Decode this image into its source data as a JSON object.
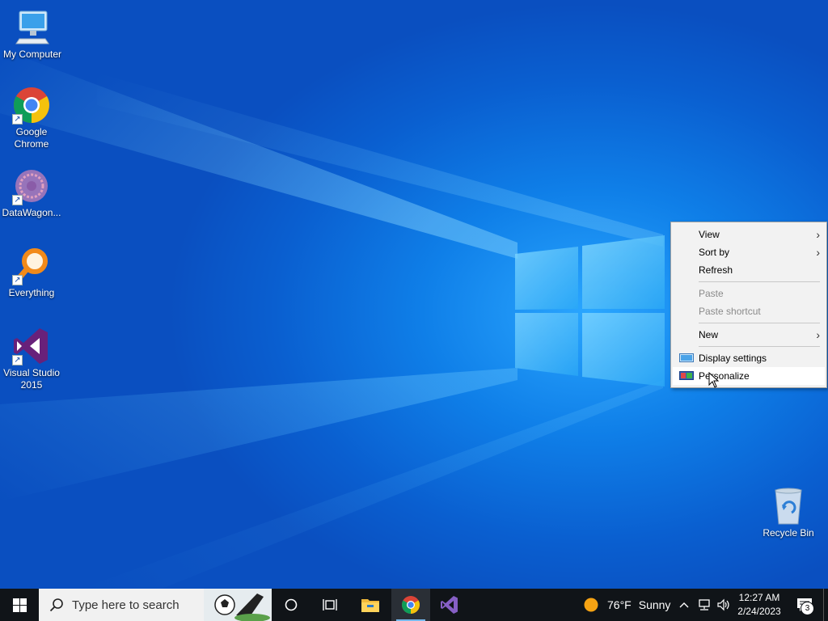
{
  "desktop": {
    "icons": [
      {
        "label": "My Computer"
      },
      {
        "label": "Google Chrome"
      },
      {
        "label": "DataWagon..."
      },
      {
        "label": "Everything"
      },
      {
        "label": "Visual Studio 2015"
      },
      {
        "label": "Recycle Bin"
      }
    ],
    "shortcut_arrow": "↗"
  },
  "context_menu": {
    "items": [
      {
        "label": "View",
        "has_submenu": true,
        "enabled": true
      },
      {
        "label": "Sort by",
        "has_submenu": true,
        "enabled": true
      },
      {
        "label": "Refresh",
        "enabled": true
      },
      {
        "label": "Paste",
        "enabled": false
      },
      {
        "label": "Paste shortcut",
        "enabled": false
      },
      {
        "label": "New",
        "has_submenu": true,
        "enabled": true
      },
      {
        "label": "Display settings",
        "icon": "display-settings-icon",
        "enabled": true
      },
      {
        "label": "Personalize",
        "icon": "personalize-icon",
        "enabled": true,
        "hovered": true
      }
    ],
    "submenu_arrow": "›"
  },
  "taskbar": {
    "search_placeholder": "Type here to search",
    "pinned": [
      "task-view-icon",
      "file-explorer-icon",
      "chrome-icon",
      "visual-studio-icon"
    ],
    "weather": {
      "temp": "76°F",
      "condition": "Sunny"
    },
    "clock": {
      "time": "12:27 AM",
      "date": "2/24/2023"
    },
    "notifications_count": "3"
  },
  "colors": {
    "taskbar_bg": "#101418",
    "desktop_blue": "#0a5fd0",
    "menu_bg": "#f2f2f2",
    "active_indicator": "#76b9ed"
  }
}
